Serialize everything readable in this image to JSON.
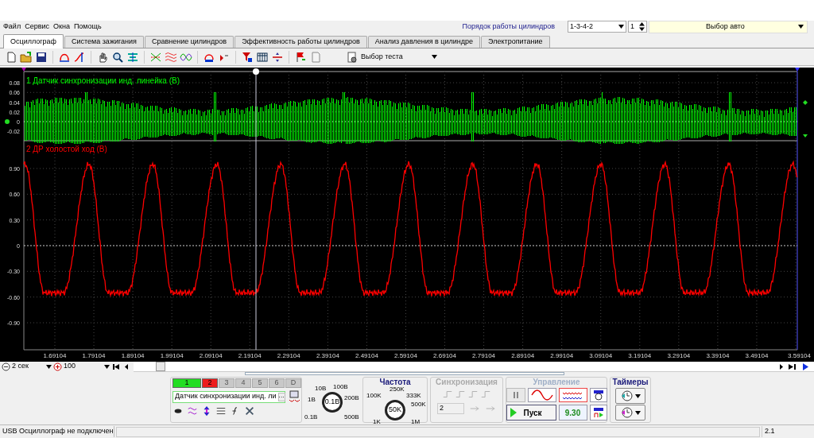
{
  "menu": [
    {
      "label": "Файл"
    },
    {
      "label": "Сервис"
    },
    {
      "label": "Окна"
    },
    {
      "label": "Помощь"
    }
  ],
  "header": {
    "order_label": "Порядок работы цилиндров",
    "order_value": "1-3-4-2",
    "cylinder": "1",
    "car_select": "Выбор авто"
  },
  "tabs": [
    {
      "label": "Осциллограф",
      "selected": true
    },
    {
      "label": "Система зажигания",
      "selected": false
    },
    {
      "label": "Сравнение цилиндров",
      "selected": false
    },
    {
      "label": "Эффективность работы цилиндров",
      "selected": false
    },
    {
      "label": "Анализ давления в цилиндре",
      "selected": false
    },
    {
      "label": "Электропитание",
      "selected": false
    }
  ],
  "toolbar": {
    "test_select": "Выбор теста"
  },
  "scope": {
    "channels": [
      {
        "title": "1 Датчик синхронизации инд. линейка (В)",
        "color": "#00ff00",
        "yticks": [
          "0.08",
          "0.06",
          "0.04",
          "0.02",
          "0",
          "-0.02"
        ]
      },
      {
        "title": "2 ДР холостой ход (В)",
        "color": "#ff0000",
        "yticks": [
          "0.90",
          "0.60",
          "0.30",
          "0",
          "-0.30",
          "-0.60",
          "-0.90"
        ]
      }
    ],
    "xticks": [
      "1.69104",
      "1.79104",
      "1.89104",
      "1.99104",
      "2.09104",
      "2.19104",
      "2.29104",
      "2.39104",
      "2.49104",
      "2.59104",
      "2.69104",
      "2.79104",
      "2.89104",
      "2.99104",
      "3.09104",
      "3.19104",
      "3.29104",
      "3.39104",
      "3.49104",
      "3.59104"
    ]
  },
  "timebar": {
    "timebase": "2 сек",
    "zoom": "100"
  },
  "controls": {
    "channel_buttons": [
      {
        "label": "1",
        "on": true,
        "color": "#22dd22"
      },
      {
        "label": "2",
        "on": true,
        "color": "#ee1c1c"
      },
      {
        "label": "3",
        "on": false
      },
      {
        "label": "4",
        "on": false
      },
      {
        "label": "5",
        "on": false
      },
      {
        "label": "6",
        "on": false
      },
      {
        "label": "D",
        "on": false
      }
    ],
    "channel_name": "Датчик синхронизации инд. ли",
    "more": "···",
    "voltage_dial": {
      "labels": [
        "10В",
        "100В",
        "1В",
        "200В",
        "0.1В",
        "500В"
      ],
      "value": "0.1В"
    },
    "frequency": {
      "title": "Частота",
      "labels": [
        "250K",
        "100K",
        "333K",
        "500K",
        "1K",
        "1M"
      ],
      "value": "50K"
    },
    "sync": {
      "title": "Синхронизация",
      "disabled": true,
      "value": "2"
    },
    "control": {
      "title": "Управление",
      "start": "Пуск",
      "reading": "9.30"
    },
    "timers": {
      "title": "Таймеры"
    }
  },
  "status_bar": [
    "USB Осциллограф не подключен",
    "2.1"
  ]
}
